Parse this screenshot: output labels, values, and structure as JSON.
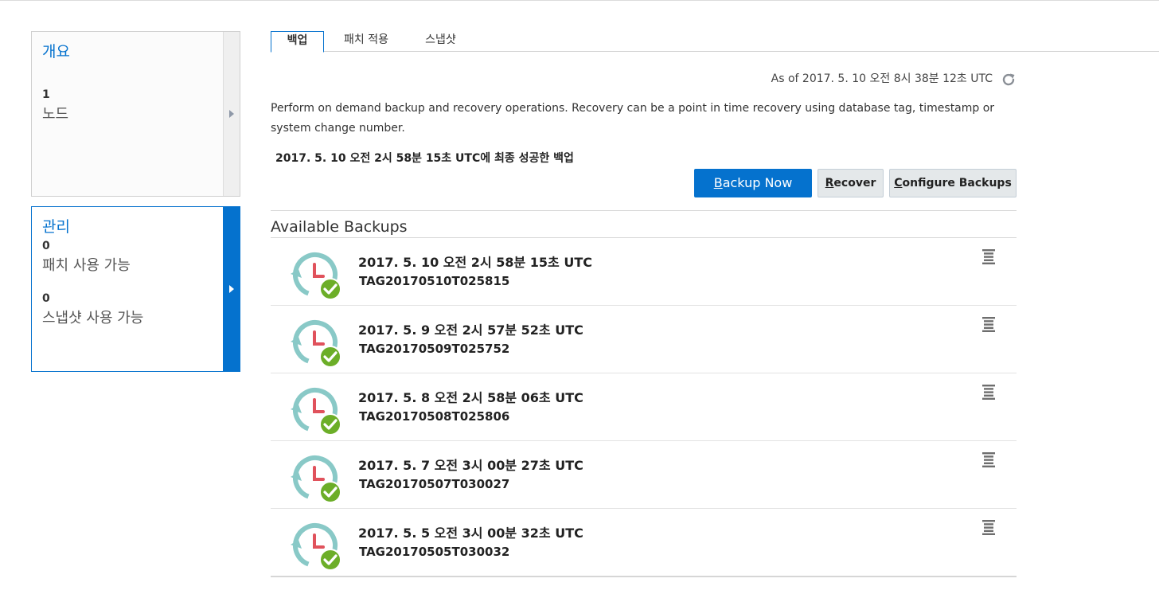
{
  "sidebar": {
    "overview": {
      "title": "개요",
      "stat_value": "1",
      "stat_label": "노드"
    },
    "management": {
      "title": "관리",
      "stats": [
        {
          "value": "0",
          "label": "패치 사용 가능"
        },
        {
          "value": "0",
          "label": "스냅샷 사용 가능"
        }
      ]
    }
  },
  "tabs": [
    "백업",
    "패치 적용",
    "스냅샷"
  ],
  "status": {
    "as_of": "As of 2017. 5. 10 오전 8시 38분 12초 UTC"
  },
  "description": "Perform on demand backup and recovery operations. Recovery can be a point in time recovery using database tag, timestamp or system change number.",
  "last_backup": "2017. 5. 10 오전 2시 58분 15초 UTC에 최종 성공한 백업",
  "buttons": {
    "backup_now_key": "B",
    "backup_now_rest": "ackup Now",
    "recover_key": "R",
    "recover_rest": "ecover",
    "configure_key": "C",
    "configure_rest": "onfigure Backups"
  },
  "backups_section": {
    "title": "Available Backups",
    "items": [
      {
        "date": "2017. 5. 10 오전 2시 58분 15초 UTC",
        "tag": "TAG20170510T025815"
      },
      {
        "date": "2017. 5. 9 오전 2시 57분 52초 UTC",
        "tag": "TAG20170509T025752"
      },
      {
        "date": "2017. 5. 8 오전 2시 58분 06초 UTC",
        "tag": "TAG20170508T025806"
      },
      {
        "date": "2017. 5. 7 오전 3시 00분 27초 UTC",
        "tag": "TAG20170507T030027"
      },
      {
        "date": "2017. 5. 5 오전 3시 00분 32초 UTC",
        "tag": "TAG20170505T030032"
      }
    ]
  },
  "colors": {
    "accent": "#0572ce",
    "success": "#6cae28",
    "clock": "#e0525c",
    "teal": "#89c9c7"
  },
  "icons": {
    "refresh": "refresh-icon",
    "backup": "backup-success-icon",
    "menu": "menu-icon",
    "expand": "chevron-right-icon"
  }
}
